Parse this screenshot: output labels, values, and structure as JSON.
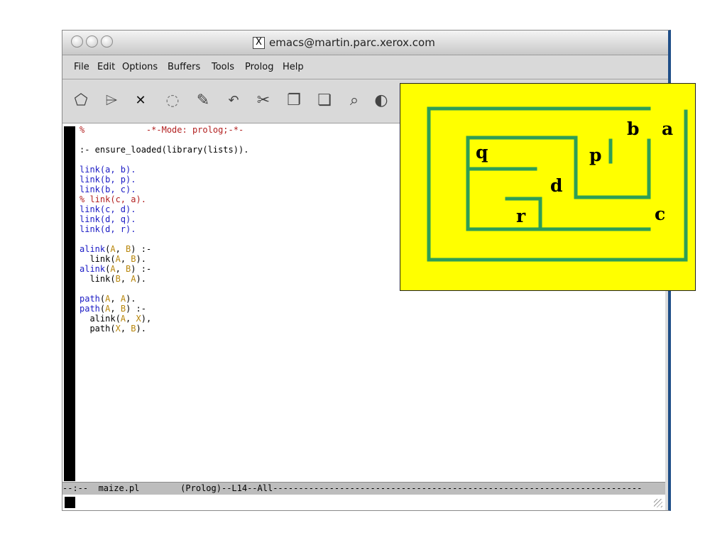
{
  "window": {
    "title": "emacs@martin.parc.xerox.com",
    "title_icon": "x-window-icon"
  },
  "menu": [
    "File",
    "Edit",
    "Options",
    "Buffers",
    "Tools",
    "Prolog",
    "Help"
  ],
  "toolbar": {
    "icons": [
      "open-file-icon",
      "open-dir-icon",
      "close-icon",
      "save-icon",
      "print-icon",
      "undo-icon",
      "cut-icon",
      "copy-icon",
      "paste-icon",
      "search-icon",
      "spell-icon"
    ]
  },
  "editor": {
    "header": "%            -*-Mode: prolog;-*-",
    "directive": ":- ensure_loaded(library(lists)).",
    "line_link_ab": "link(a, b).",
    "line_link_bp": "link(b, p).",
    "line_link_bc": "link(b, c).",
    "line_commented": "% link(c, a).",
    "line_link_cd": "link(c, d).",
    "line_link_dq": "link(d, q).",
    "line_link_dr": "link(d, r)."
  },
  "modeline": "--:--  maize.pl        (Prolog)--L14--All------------------------------------------------------------------------",
  "maze": {
    "labels": [
      "a",
      "b",
      "c",
      "d",
      "p",
      "q",
      "r"
    ],
    "background": "#ffff00",
    "wall_color": "#2e9e56"
  },
  "colors": {
    "comment": "#b21f1f",
    "functor": "#1a1ac4",
    "variable": "#b8860b"
  }
}
